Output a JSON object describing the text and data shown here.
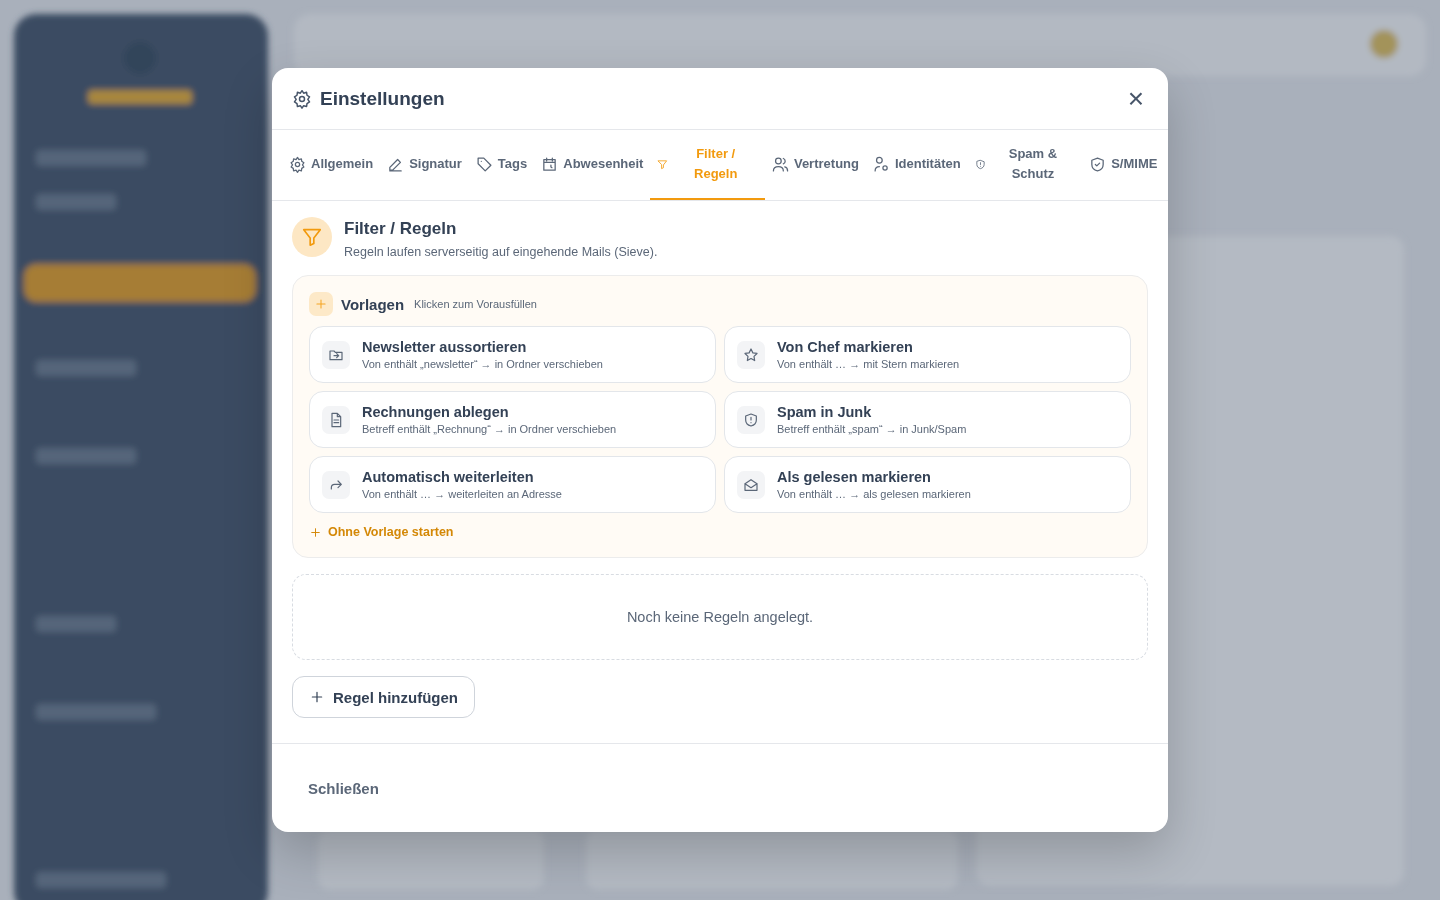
{
  "dialog": {
    "title": "Einstellungen",
    "close": "×"
  },
  "tabs": [
    {
      "label": "Allgemein",
      "kind": "gear",
      "selected": false
    },
    {
      "label": "Signatur",
      "kind": "pen",
      "selected": false
    },
    {
      "label": "Tags",
      "kind": "tag",
      "selected": false
    },
    {
      "label": "Abwesenheit",
      "kind": "calendar",
      "selected": false
    },
    {
      "label": "Filter / Regeln",
      "kind": "filter",
      "selected": true
    },
    {
      "label": "Vertretung",
      "kind": "users",
      "selected": false
    },
    {
      "label": "Identitäten",
      "kind": "identity",
      "selected": false
    },
    {
      "label": "Spam & Schutz",
      "kind": "shield",
      "selected": false
    },
    {
      "label": "S/MIME",
      "kind": "shieldcheck",
      "selected": false
    }
  ],
  "section": {
    "title": "Filter / Regeln",
    "description": "Regeln laufen serverseitig auf eingehende Mails (Sieve)."
  },
  "templates": {
    "title": "Vorlagen",
    "hint": "Klicken zum Vorausfüllen",
    "start_blank": "Ohne Vorlage starten",
    "items": [
      {
        "title": "Newsletter aussortieren",
        "detail": "Von enthält „newsletter“ → in Ordner verschieben",
        "kind": "folder"
      },
      {
        "title": "Von Chef markieren",
        "detail": "Von enthält … → mit Stern markieren",
        "kind": "star"
      },
      {
        "title": "Rechnungen ablegen",
        "detail": "Betreff enthält „Rechnung“ → in Ordner verschieben",
        "kind": "document"
      },
      {
        "title": "Spam in Junk",
        "detail": "Betreff enthält „spam“ → in Junk/Spam",
        "kind": "shield"
      },
      {
        "title": "Automatisch weiterleiten",
        "detail": "Von enthält … → weiterleiten an Adresse",
        "kind": "forward"
      },
      {
        "title": "Als gelesen markieren",
        "detail": "Von enthält … → als gelesen markieren",
        "kind": "envelope"
      }
    ]
  },
  "empty_state": "Noch keine Regeln angelegt.",
  "add_rule": "Regel hinzufügen",
  "footer": {
    "close": "Schließen"
  }
}
